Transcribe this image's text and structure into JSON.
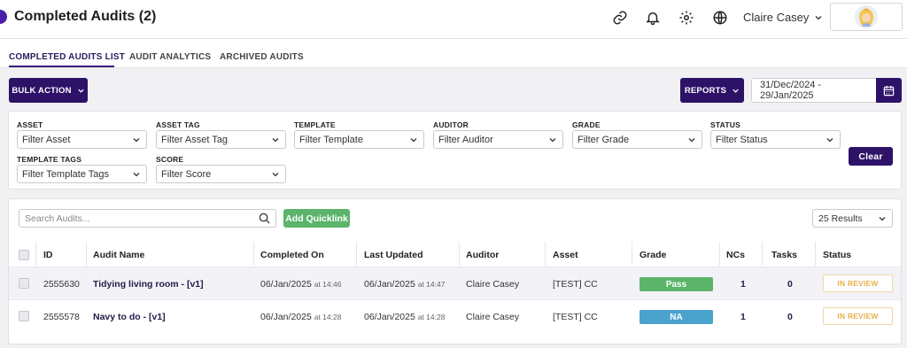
{
  "header": {
    "title": "Completed Audits (2)",
    "user_name": "Claire Casey",
    "icons": [
      "link-icon",
      "bell-icon",
      "gear-icon",
      "globe-icon"
    ]
  },
  "tabs": [
    {
      "label": "COMPLETED AUDITS LIST",
      "active": true
    },
    {
      "label": "AUDIT ANALYTICS",
      "active": false
    },
    {
      "label": "ARCHIVED AUDITS",
      "active": false
    }
  ],
  "toolbar": {
    "bulk_action_label": "BULK ACTION",
    "reports_label": "REPORTS",
    "date_range": "31/Dec/2024 - 29/Jan/2025"
  },
  "filters": {
    "asset": {
      "label": "ASSET",
      "placeholder": "Filter Asset"
    },
    "asset_tag": {
      "label": "ASSET TAG",
      "placeholder": "Filter Asset Tag"
    },
    "template": {
      "label": "TEMPLATE",
      "placeholder": "Filter Template"
    },
    "auditor": {
      "label": "AUDITOR",
      "placeholder": "Filter Auditor"
    },
    "grade": {
      "label": "GRADE",
      "placeholder": "Filter Grade"
    },
    "status": {
      "label": "STATUS",
      "placeholder": "Filter Status"
    },
    "template_tags": {
      "label": "TEMPLATE TAGS",
      "placeholder": "Filter Template Tags"
    },
    "score": {
      "label": "SCORE",
      "placeholder": "Filter Score"
    },
    "clear_label": "Clear"
  },
  "list": {
    "search_placeholder": "Search Audits...",
    "quicklink_label": "Add Quicklink",
    "results_per_page": "25 Results",
    "columns": [
      "ID",
      "Audit Name",
      "Completed On",
      "Last Updated",
      "Auditor",
      "Asset",
      "Grade",
      "NCs",
      "Tasks",
      "Status"
    ],
    "rows": [
      {
        "id": "2555630",
        "name": "Tidying living room - [v1]",
        "completed_date": "06/Jan/2025",
        "completed_time": "at 14:46",
        "updated_date": "06/Jan/2025",
        "updated_time": "at 14:47",
        "auditor": "Claire Casey",
        "asset": "[TEST] CC",
        "grade": "Pass",
        "grade_color": "#5bb46a",
        "ncs": "1",
        "tasks": "0",
        "status": "IN REVIEW"
      },
      {
        "id": "2555578",
        "name": "Navy to do - [v1]",
        "completed_date": "06/Jan/2025",
        "completed_time": "at 14:28",
        "updated_date": "06/Jan/2025",
        "updated_time": "at 14:28",
        "auditor": "Claire Casey",
        "asset": "[TEST] CC",
        "grade": "NA",
        "grade_color": "#4aa3cc",
        "ncs": "1",
        "tasks": "0",
        "status": "IN REVIEW"
      }
    ]
  },
  "colors": {
    "primary": "#2d1268",
    "success": "#5bb46a",
    "info": "#4aa3cc",
    "warning": "#e8b04c"
  }
}
